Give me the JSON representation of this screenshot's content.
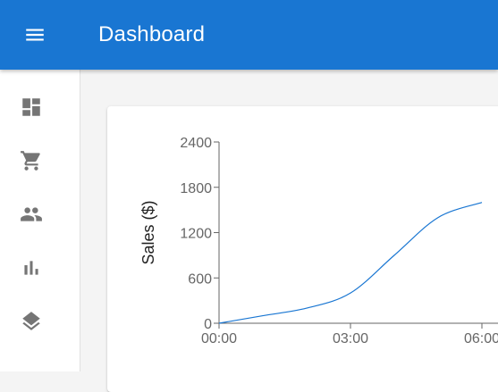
{
  "appbar": {
    "title": "Dashboard",
    "menu_icon": "menu-icon",
    "background": "#1976d2"
  },
  "sidebar": {
    "items": [
      {
        "icon": "dashboard-icon"
      },
      {
        "icon": "shopping-cart-icon"
      },
      {
        "icon": "people-icon"
      },
      {
        "icon": "bar-chart-icon"
      },
      {
        "icon": "layers-icon"
      }
    ]
  },
  "chart_data": {
    "type": "line",
    "ylabel": "Sales ($)",
    "xlabel": "",
    "x_ticks": [
      "00:00",
      "03:00",
      "06:00"
    ],
    "y_ticks": [
      0,
      600,
      1200,
      1800,
      2400
    ],
    "ylim": [
      0,
      2400
    ],
    "grid": false,
    "series": [
      {
        "color": "#1976d2",
        "x": [
          "00:00",
          "01:00",
          "02:00",
          "03:00",
          "04:00",
          "05:00",
          "06:00"
        ],
        "values": [
          0,
          100,
          200,
          400,
          900,
          1400,
          1600
        ]
      }
    ]
  }
}
